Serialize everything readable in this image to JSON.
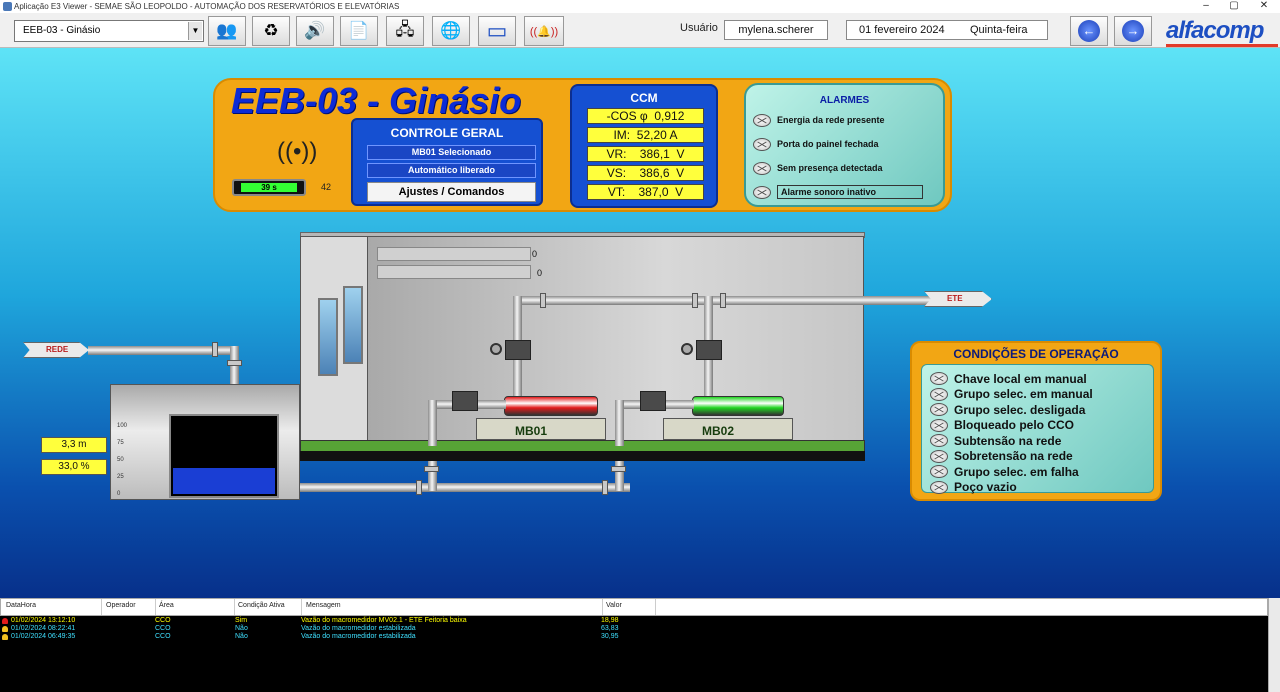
{
  "window": {
    "title": "Aplicação E3 Viewer - SEMAE SÃO LEOPOLDO - AUTOMAÇÃO DOS RESERVATÓRIOS E ELEVATÓRIAS",
    "minimize": "–",
    "maximize": "▢",
    "close": "✕"
  },
  "toolbar": {
    "screen_selected": "EEB-03  -  Ginásio",
    "buttons": [
      {
        "icon": "users-icon",
        "glyph": "👥"
      },
      {
        "icon": "refresh-icon",
        "glyph": "♻"
      },
      {
        "icon": "speaker-icon",
        "glyph": "🔊"
      },
      {
        "icon": "report-icon",
        "glyph": "📄"
      },
      {
        "icon": "network-icon",
        "glyph": "🖧"
      },
      {
        "icon": "globe-icon",
        "glyph": "🌐"
      },
      {
        "icon": "monitor-icon",
        "glyph": "▭"
      },
      {
        "icon": "alarm-bell-icon",
        "glyph": "((🔔))"
      }
    ],
    "user_label": "Usuário",
    "user_value": "mylena.scherer",
    "date_value": "01 fevereiro 2024",
    "weekday_value": "Quinta-feira",
    "back_glyph": "←",
    "forward_glyph": "→",
    "logo": "alfacomp"
  },
  "station": {
    "title": "EEB-03 - Ginásio",
    "radio_value": "39  s",
    "radio_number": "42"
  },
  "controle_geral": {
    "title": "CONTROLE GERAL",
    "items": [
      "MB01 Selecionado",
      "Automático liberado"
    ],
    "button": "Ajustes / Comandos"
  },
  "ccm": {
    "title": "CCM",
    "values": [
      "-COS φ  0,912",
      "IM:  52,20 A",
      "VR:    386,1  V",
      "VS:    386,6  V",
      "VT:    387,0  V"
    ]
  },
  "alarmes": {
    "title": "ALARMES",
    "items": [
      "Energia da rede presente",
      "Porta do painel fechada",
      "Sem presença detectada",
      "Alarme sonoro inativo"
    ]
  },
  "process": {
    "level_bar_1_value": "0",
    "level_bar_2_value": "0",
    "tank_level_m": "3,3 m",
    "tank_level_pct": "33,0 %",
    "tank_fill_fraction": 0.33,
    "tank_scale": [
      "100",
      "75",
      "50",
      "25",
      "0"
    ],
    "inlet_label": "REDE",
    "outlet_label": "ETE",
    "pumps": [
      {
        "name": "MB01",
        "status_color": "#e21b1b"
      },
      {
        "name": "MB02",
        "status_color": "#21d421"
      }
    ]
  },
  "condicoes": {
    "title": "CONDIÇÕES DE OPERAÇÃO",
    "items": [
      "Chave local em manual",
      "Grupo selec. em manual",
      "Grupo selec. desligada",
      "Bloqueado pelo CCO",
      "Subtensão na rede",
      "Sobretensão na rede",
      "Grupo selec. em falha",
      "Poço vazio"
    ]
  },
  "events": {
    "columns": [
      "DataHora",
      "Operador",
      "Área",
      "Condição Ativa",
      "Mensagem",
      "Valor"
    ],
    "rows": [
      {
        "datetime": "01/02/2024 13:12:10",
        "operator": "",
        "area": "CCO",
        "condition": "Sim",
        "message": "Vazão do macromedidor MV02.1 - ETE Feitoria baixa",
        "value": "18,98",
        "color": "#ffff00",
        "bell": "#e21b1b"
      },
      {
        "datetime": "01/02/2024 08:22:41",
        "operator": "",
        "area": "CCO",
        "condition": "Não",
        "message": "Vazão do macromedidor estabilizada",
        "value": "63,83",
        "color": "#3fe0ff",
        "bell": "#f2c020"
      },
      {
        "datetime": "01/02/2024 06:49:35",
        "operator": "",
        "area": "CCO",
        "condition": "Não",
        "message": "Vazão do macromedidor estabilizada",
        "value": "30,95",
        "color": "#3fe0ff",
        "bell": "#f2c020"
      }
    ]
  }
}
